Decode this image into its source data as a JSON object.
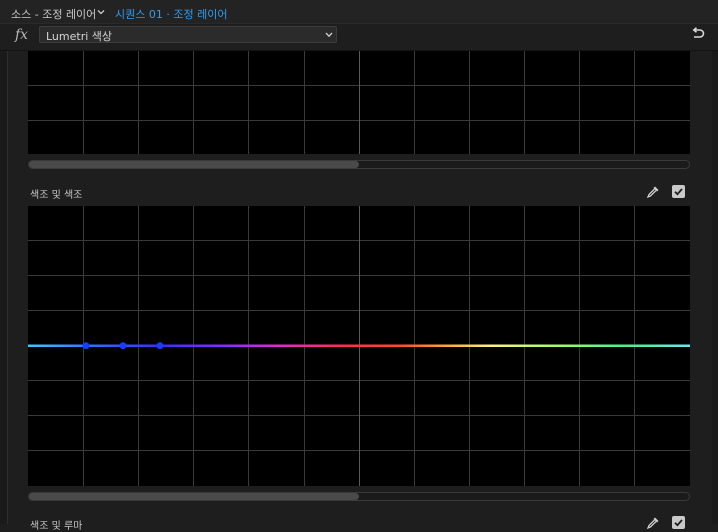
{
  "header": {
    "source_tab": "소스 - 조정 레이어",
    "sequence_tab": "시퀀스 01 · 조정 레이어"
  },
  "effect": {
    "fx_label": "fx",
    "selected": "Lumetri 색상"
  },
  "sections": [
    {
      "label": "",
      "enabled": true
    },
    {
      "label": "색조 및 색조",
      "enabled": true,
      "control_points": 3
    },
    {
      "label": "색조 및 루마",
      "enabled": true
    }
  ],
  "colors": {
    "accent": "#2d9cf0",
    "panel_bg": "#000000",
    "point": "#1a3cff"
  },
  "icons": [
    "chevron-down-icon",
    "reset-icon",
    "eyedropper-icon",
    "checkbox-icon"
  ]
}
